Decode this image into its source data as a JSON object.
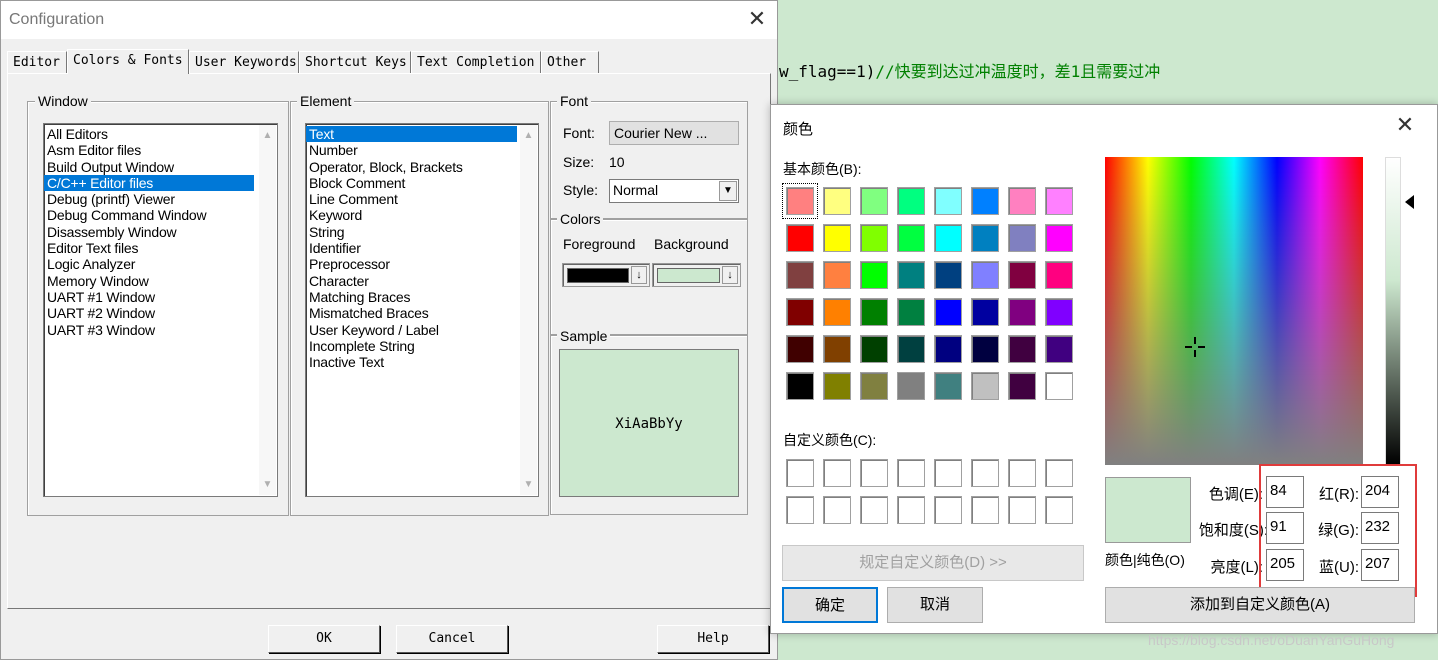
{
  "editor": {
    "code_prefix": "w_flag==1)",
    "code_comment": "//快要到达过冲温度时，差1且需要过冲",
    "watermark": "https://blog.csdn.net/oDuanYanGuHong"
  },
  "config": {
    "title": "Configuration",
    "close": "✕",
    "tabs": [
      "Editor",
      "Colors & Fonts",
      "User Keywords",
      "Shortcut Keys",
      "Text Completion",
      "Other"
    ],
    "window": {
      "label": "Window",
      "items": [
        "All Editors",
        "Asm Editor files",
        "Build Output Window",
        "C/C++ Editor files",
        "Debug (printf) Viewer",
        "Debug Command Window",
        "Disassembly Window",
        "Editor Text files",
        "Logic Analyzer",
        "Memory Window",
        "UART #1 Window",
        "UART #2 Window",
        "UART #3 Window"
      ],
      "selected": 3
    },
    "element": {
      "label": "Element",
      "items": [
        "Text",
        "Number",
        "Operator, Block, Brackets",
        "Block Comment",
        "Line Comment",
        "Keyword",
        "String",
        "Identifier",
        "Preprocessor",
        "Character",
        "Matching Braces",
        "Mismatched Braces",
        "User Keyword / Label",
        "Incomplete String",
        "Inactive Text"
      ],
      "selected": 0
    },
    "font": {
      "label": "Font",
      "font_label": "Font:",
      "font_value": "Courier New ...",
      "size_label": "Size:",
      "size_value": "10",
      "style_label": "Style:",
      "style_value": "Normal"
    },
    "colors": {
      "label": "Colors",
      "fg_label": "Foreground",
      "bg_label": "Background",
      "fg_color": "#000000",
      "bg_color": "#cce8cf"
    },
    "sample": {
      "label": "Sample",
      "text": "XiAaBbYy",
      "bg": "#cce8cf"
    },
    "buttons": {
      "ok": "OK",
      "cancel": "Cancel",
      "help": "Help"
    }
  },
  "color_dialog": {
    "title": "颜色",
    "close": "✕",
    "basic_label": "基本颜色(B):",
    "basic_colors": [
      "#ff8080",
      "#ffff80",
      "#80ff80",
      "#00ff80",
      "#80ffff",
      "#0080ff",
      "#ff80c0",
      "#ff80ff",
      "#ff0000",
      "#ffff00",
      "#80ff00",
      "#00ff40",
      "#00ffff",
      "#0080c0",
      "#8080c0",
      "#ff00ff",
      "#804040",
      "#ff8040",
      "#00ff00",
      "#008080",
      "#004080",
      "#8080ff",
      "#800040",
      "#ff0080",
      "#800000",
      "#ff8000",
      "#008000",
      "#008040",
      "#0000ff",
      "#0000a0",
      "#800080",
      "#8000ff",
      "#400000",
      "#804000",
      "#004000",
      "#004040",
      "#000080",
      "#000040",
      "#400040",
      "#400080",
      "#000000",
      "#808000",
      "#808040",
      "#808080",
      "#408080",
      "#c0c0c0",
      "#400040",
      "#ffffff"
    ],
    "custom_label": "自定义颜色(C):",
    "custom_count": 16,
    "define_custom": "规定自定义颜色(D) >>",
    "preview_label": "颜色|纯色(O)",
    "preview_color": "#cce8cf",
    "hue_label": "色调(E):",
    "hue": "84",
    "sat_label": "饱和度(S):",
    "sat": "91",
    "lum_label": "亮度(L):",
    "lum": "205",
    "red_label": "红(R):",
    "red": "204",
    "green_label": "绿(G):",
    "green": "232",
    "blue_label": "蓝(U):",
    "blue": "207",
    "ok": "确定",
    "cancel": "取消",
    "add_custom": "添加到自定义颜色(A)"
  }
}
